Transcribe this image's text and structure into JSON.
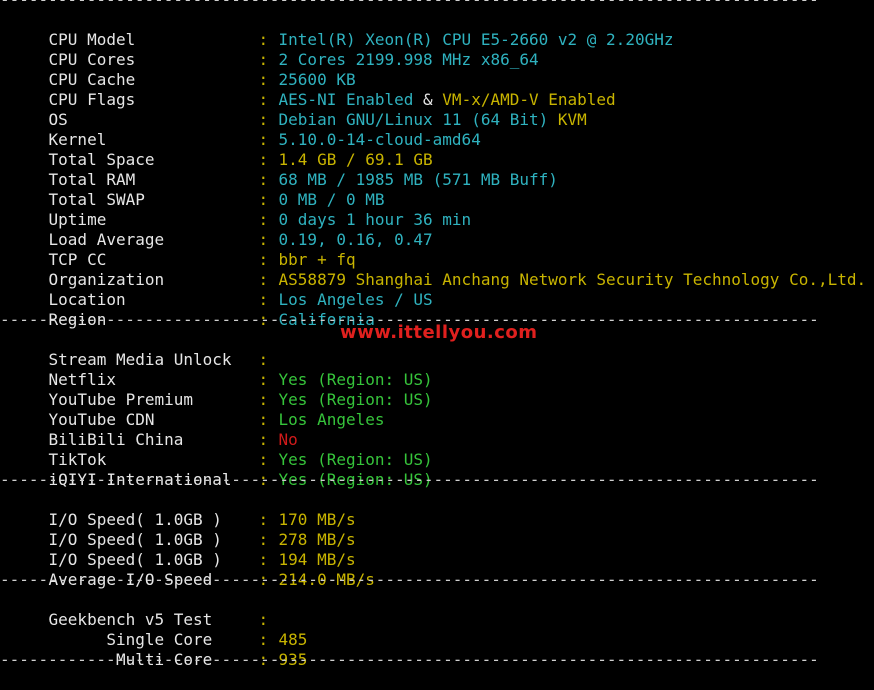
{
  "colors": {
    "background": "#000000",
    "label": "#e6e6e6",
    "cyan": "#2fb2bf",
    "yellow": "#c8b400",
    "green": "#36c43b",
    "red": "#d01a1a",
    "watermark": "#e0201e"
  },
  "divider_text": "--------------------------------------------------------------------------------------",
  "watermark": "www.ittellyou.com",
  "system": {
    "cpu_model": {
      "key": "CPU Model",
      "value": "Intel(R) Xeon(R) CPU E5-2660 v2 @ 2.20GHz"
    },
    "cpu_cores": {
      "key": "CPU Cores",
      "value": "2 Cores 2199.998 MHz x86_64"
    },
    "cpu_cache": {
      "key": "CPU Cache",
      "value": "25600 KB"
    },
    "cpu_flags": {
      "key": "CPU Flags",
      "value_a": "AES-NI Enabled",
      "amp": " & ",
      "value_b": "VM-x/AMD-V Enabled"
    },
    "os": {
      "key": "OS",
      "value_a": "Debian GNU/Linux 11 (64 Bit)",
      "value_b": " KVM"
    },
    "kernel": {
      "key": "Kernel",
      "value": "5.10.0-14-cloud-amd64"
    },
    "total_space": {
      "key": "Total Space",
      "value": "1.4 GB / 69.1 GB"
    },
    "total_ram": {
      "key": "Total RAM",
      "value": "68 MB / 1985 MB (571 MB Buff)"
    },
    "total_swap": {
      "key": "Total SWAP",
      "value": "0 MB / 0 MB"
    },
    "uptime": {
      "key": "Uptime",
      "value": "0 days 1 hour 36 min"
    },
    "load_average": {
      "key": "Load Average",
      "value": "0.19, 0.16, 0.47"
    },
    "tcp_cc": {
      "key": "TCP CC",
      "value": "bbr + fq"
    },
    "organization": {
      "key": "Organization",
      "value": "AS58879 Shanghai Anchang Network Security Technology Co.,Ltd."
    },
    "location": {
      "key": "Location",
      "value": "Los Angeles / US"
    },
    "region": {
      "key": "Region",
      "value": "California"
    }
  },
  "stream": {
    "header": {
      "key": "Stream Media Unlock"
    },
    "netflix": {
      "key": "Netflix",
      "value": "Yes (Region: US)"
    },
    "youtube_premium": {
      "key": "YouTube Premium",
      "value": "Yes (Region: US)"
    },
    "youtube_cdn": {
      "key": "YouTube CDN",
      "value": "Los Angeles"
    },
    "bilibili": {
      "key": "BiliBili China",
      "value": "No"
    },
    "tiktok": {
      "key": "TikTok",
      "value": "Yes (Region: US)"
    },
    "iqiyi": {
      "key": "iQIYI International",
      "value": "Yes (Region: US)"
    }
  },
  "io": {
    "run1": {
      "key": "I/O Speed( 1.0GB )",
      "value": "170 MB/s"
    },
    "run2": {
      "key": "I/O Speed( 1.0GB )",
      "value": "278 MB/s"
    },
    "run3": {
      "key": "I/O Speed( 1.0GB )",
      "value": "194 MB/s"
    },
    "average": {
      "key": "Average I/O Speed",
      "value": "214.0 MB/s"
    }
  },
  "geekbench": {
    "header": {
      "key": "Geekbench v5 Test"
    },
    "single": {
      "key": "      Single Core",
      "value": "485"
    },
    "multi": {
      "key": "       Multi Core",
      "value": "935"
    }
  },
  "colon": ": "
}
